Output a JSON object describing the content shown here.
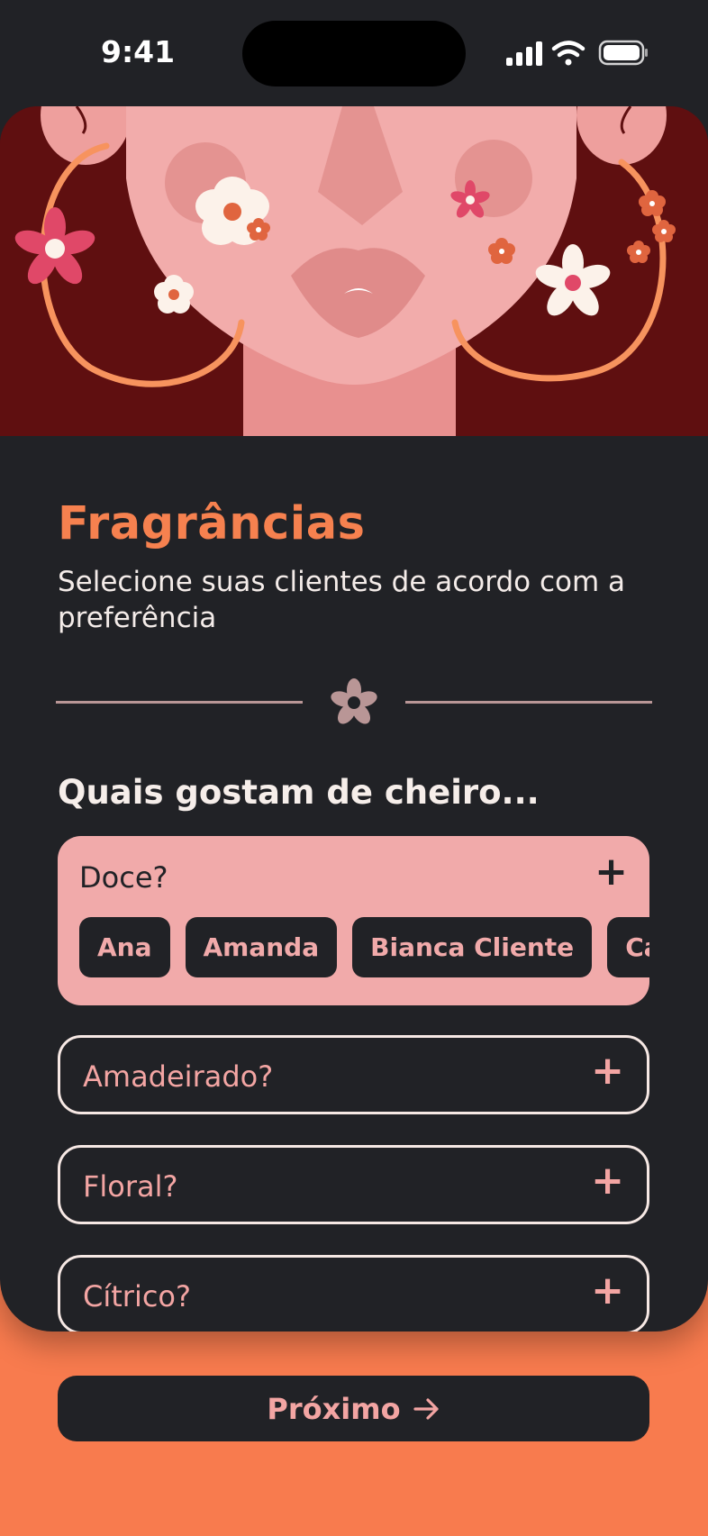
{
  "status_bar": {
    "time": "9:41",
    "icons": [
      "cellular-signal-icon",
      "wifi-icon",
      "battery-icon"
    ]
  },
  "hero": {
    "illustration": "woman-face-with-flowers-illustration"
  },
  "header": {
    "title": "Fragrâncias",
    "subtitle": "Selecione suas clientes de acordo com a preferência"
  },
  "divider": {
    "icon": "flower-icon"
  },
  "question": {
    "title": "Quais gostam de cheiro..."
  },
  "categories": [
    {
      "label": "Doce?",
      "expanded": true,
      "action_icon": "plus-icon",
      "clients": [
        "Ana",
        "Amanda",
        "Bianca Cliente",
        "Carol cliente"
      ]
    },
    {
      "label": "Amadeirado?",
      "expanded": false,
      "action_icon": "plus-icon"
    },
    {
      "label": "Floral?",
      "expanded": false,
      "action_icon": "plus-icon"
    },
    {
      "label": "Cítrico?",
      "expanded": false,
      "action_icon": "plus-icon"
    }
  ],
  "footer": {
    "next_label": "Próximo",
    "next_icon": "arrow-right-icon"
  },
  "colors": {
    "accent": "#F6814F",
    "background_orange": "#F87B4E",
    "card_dark": "#212226",
    "pink": "#F1AAAA",
    "hero_bg": "#5F0F10"
  }
}
